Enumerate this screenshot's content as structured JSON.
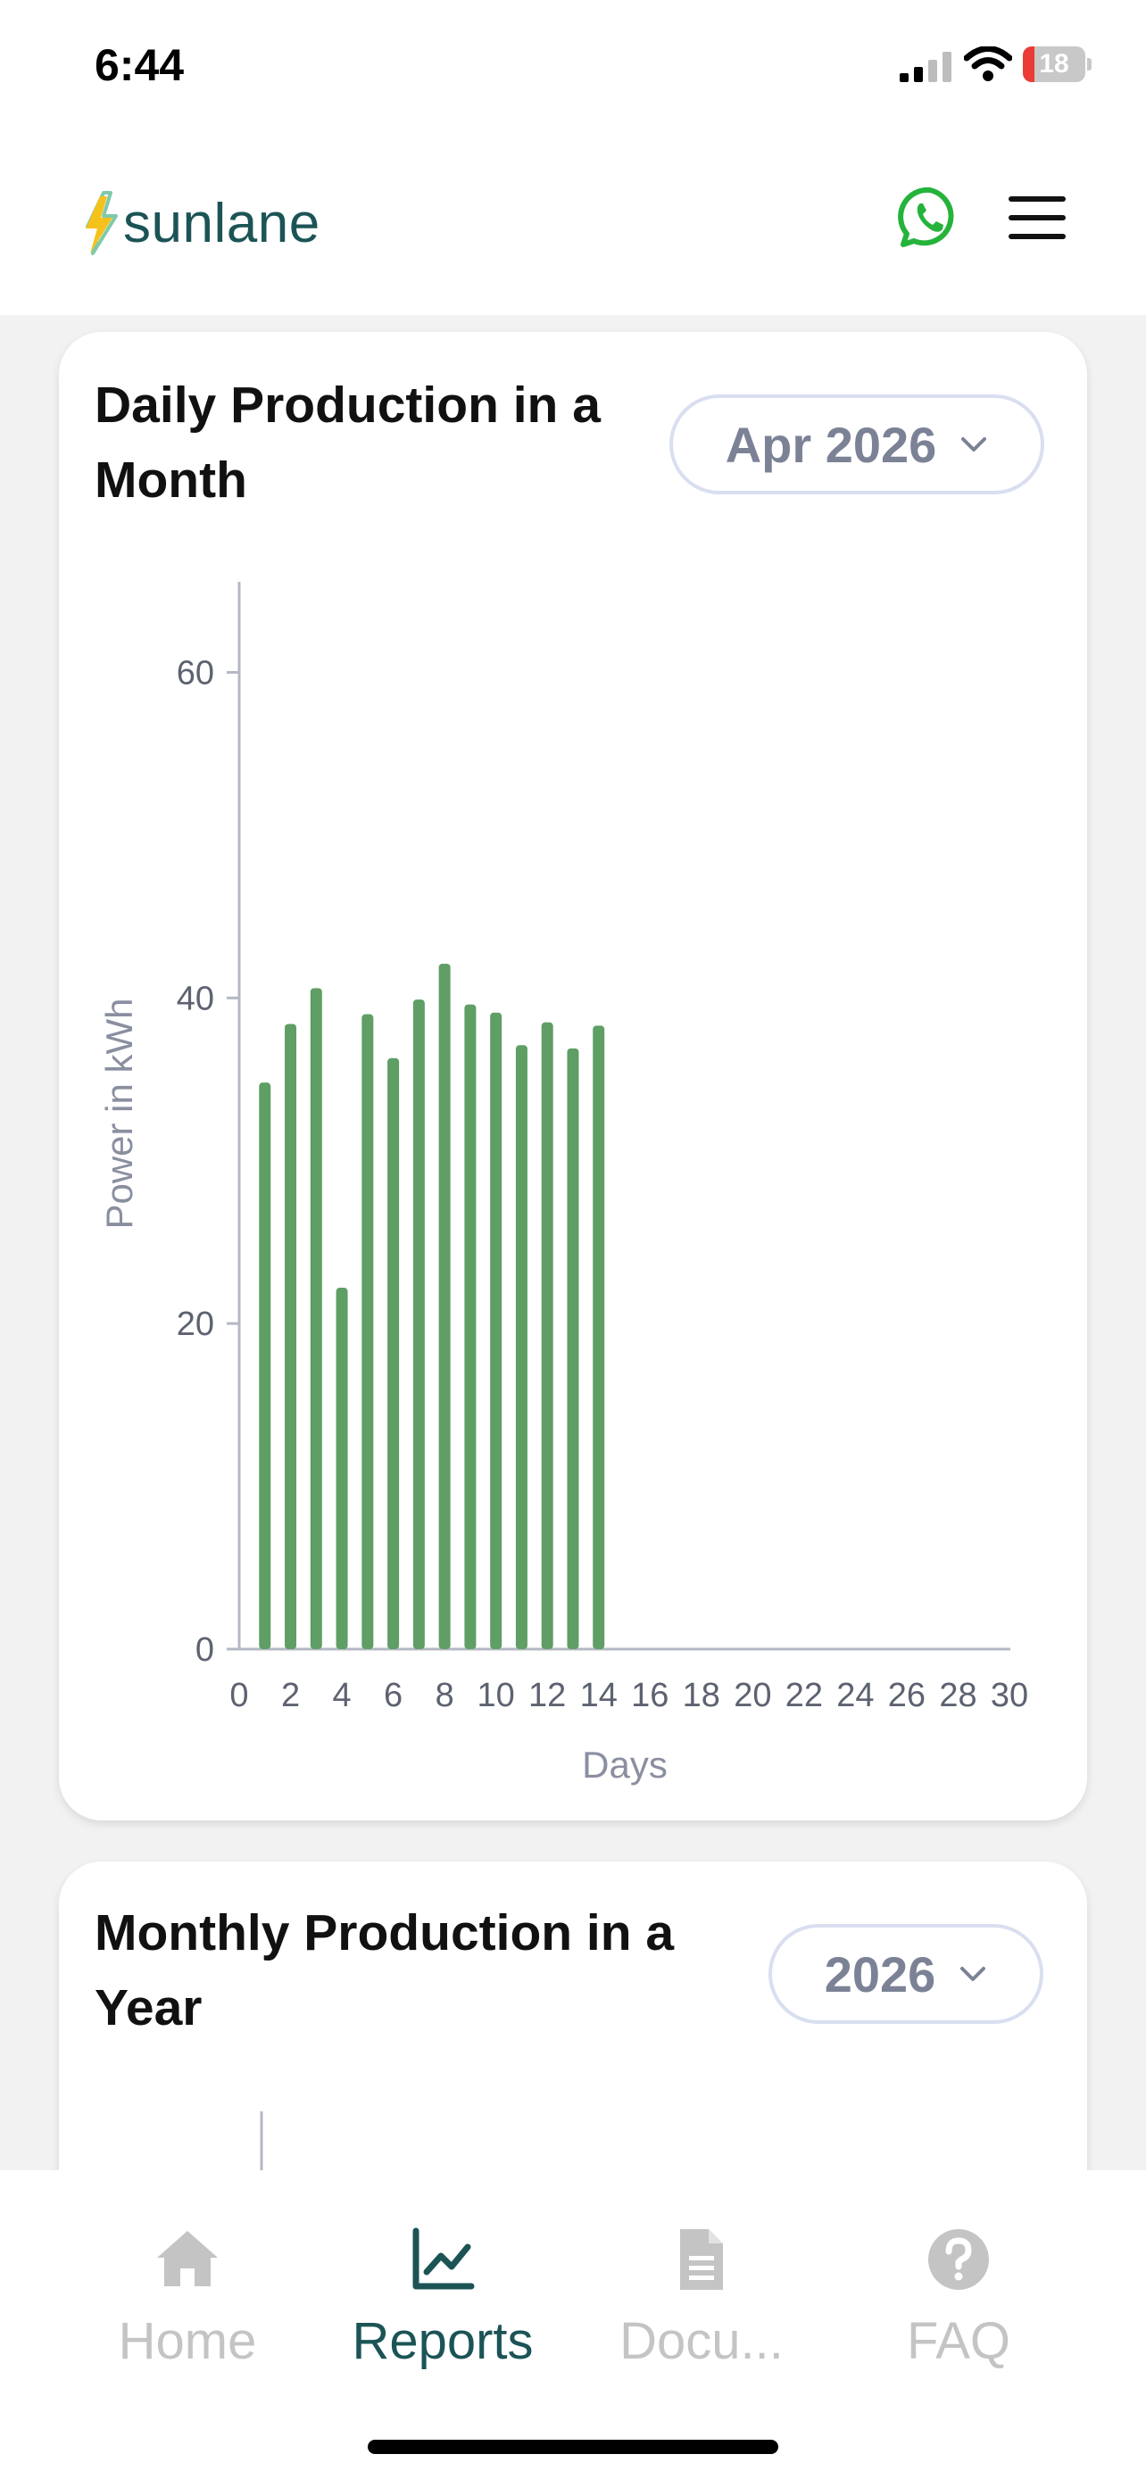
{
  "status_bar": {
    "time": "6:44",
    "battery_level": "18",
    "battery_fraction": 0.18
  },
  "header": {
    "logo_text": "sunlane"
  },
  "daily_card": {
    "title": "Daily Production in a Month",
    "picker_value": "Apr 2026"
  },
  "monthly_card": {
    "title": "Monthly Production in a Year",
    "picker_value": "2026"
  },
  "chart_data": {
    "type": "bar",
    "title": "Daily Production in a Month",
    "xlabel": "Days",
    "ylabel": "Power in kWh",
    "x": [
      1,
      2,
      3,
      4,
      5,
      6,
      7,
      8,
      9,
      10,
      11,
      12,
      13,
      14
    ],
    "values": [
      34.8,
      38.4,
      40.6,
      22.2,
      39.0,
      36.3,
      39.9,
      42.1,
      39.6,
      39.1,
      37.1,
      38.5,
      36.9,
      38.3
    ],
    "xlim": [
      0,
      30
    ],
    "ylim": [
      0,
      66
    ],
    "xticks": [
      "0",
      "2",
      "4",
      "6",
      "8",
      "10",
      "12",
      "14",
      "16",
      "18",
      "20",
      "22",
      "24",
      "26",
      "28",
      "30"
    ],
    "yticks": [
      "0",
      "20",
      "40",
      "60"
    ],
    "bar_color": "#5f9e64",
    "grid": false
  },
  "bottom_nav": {
    "items": [
      {
        "label": "Home",
        "icon": "home-icon",
        "active": false
      },
      {
        "label": "Reports",
        "icon": "chart-icon",
        "active": true
      },
      {
        "label": "Docu...",
        "icon": "document-icon",
        "active": false
      },
      {
        "label": "FAQ",
        "icon": "help-icon",
        "active": false
      }
    ]
  },
  "colors": {
    "brand": "#1c5456",
    "bolt_yellow": "#f5c21b",
    "bolt_green": "#7fc9a9",
    "whatsapp": "#25b33b",
    "bar": "#5f9e64",
    "inactive": "#c4c4c4"
  }
}
